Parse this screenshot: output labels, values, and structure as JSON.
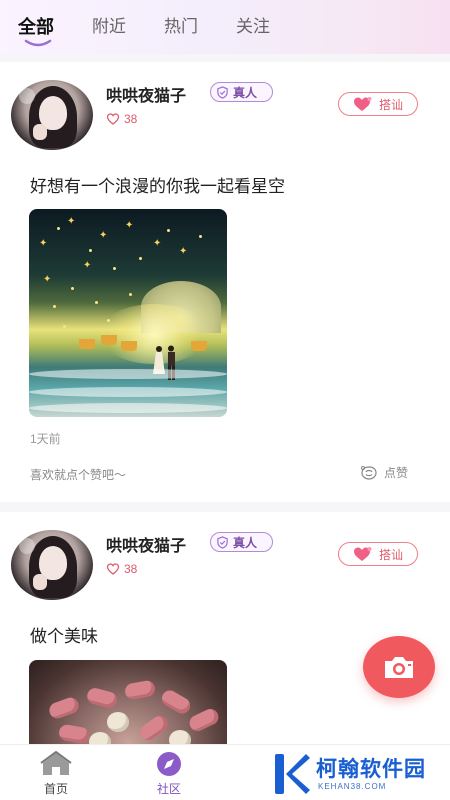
{
  "tabs": [
    {
      "label": "全部",
      "active": true
    },
    {
      "label": "附近",
      "active": false
    },
    {
      "label": "热门",
      "active": false
    },
    {
      "label": "关注",
      "active": false
    }
  ],
  "posts": [
    {
      "username": "哄哄夜猫子",
      "verified_label": "真人",
      "like_count": "38",
      "chat_label": "搭讪",
      "text": "好想有一个浪漫的你我一起看星空",
      "image": "starry-beach-couple-photo",
      "time": "1天前",
      "like_hint": "喜欢就点个赞吧～",
      "like_action": "点赞"
    },
    {
      "username": "哄哄夜猫子",
      "verified_label": "真人",
      "like_count": "38",
      "chat_label": "搭讪",
      "text": "做个美味",
      "image": "peanut-snack-bowl-photo"
    }
  ],
  "fab": {
    "icon": "camera-icon"
  },
  "bottom_nav": [
    {
      "label": "首页",
      "icon": "home-icon"
    },
    {
      "label": "社区",
      "icon": "compass-icon",
      "active": true
    }
  ],
  "watermark": {
    "name": "柯翰软件园",
    "url": "KEHAN38.COM"
  },
  "colors": {
    "accent": "#7d52b8",
    "like": "#e05a6b",
    "fab": "#f05a5e",
    "verified": "#b48ad6"
  }
}
